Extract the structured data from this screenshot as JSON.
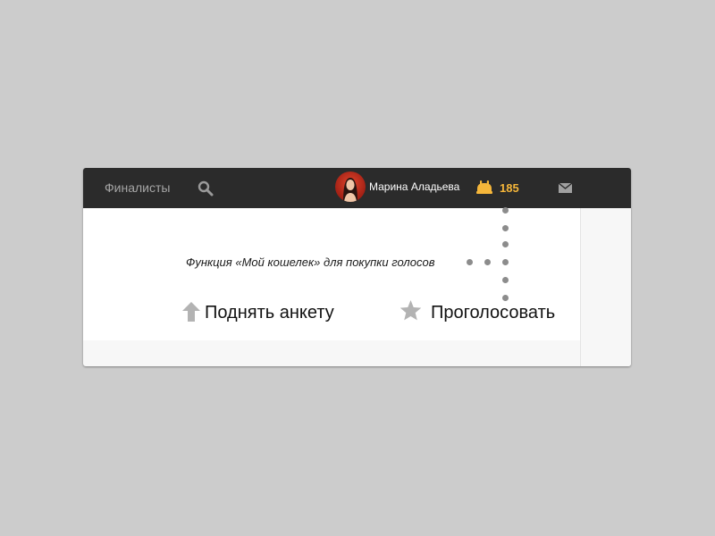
{
  "topbar": {
    "nav_label": "Финалисты",
    "search_icon": "search-icon",
    "user": {
      "name": "Марина Аладьева",
      "avatar_icon": "avatar"
    },
    "wallet": {
      "icon": "wallet-icon",
      "count": "185",
      "color": "#f5b63a"
    },
    "mail_icon": "mail-icon"
  },
  "hint": {
    "text": "Функция «Мой кошелек» для покупки голосов"
  },
  "actions": {
    "raise": {
      "icon": "arrow-up-icon",
      "label": "Поднять анкету"
    },
    "vote": {
      "icon": "star-icon",
      "label": "Проголосовать"
    }
  },
  "colors": {
    "page_bg": "#cccccc",
    "topbar_bg": "#2b2b2b",
    "accent": "#f5b63a",
    "icon_gray": "#b3b3b3"
  }
}
